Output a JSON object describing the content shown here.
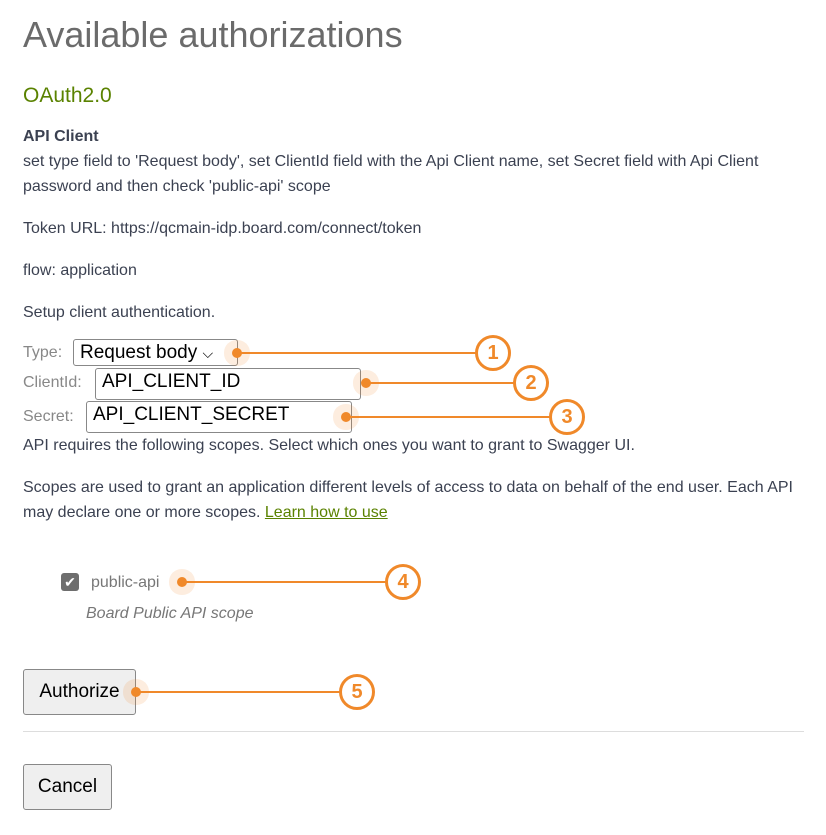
{
  "title": "Available authorizations",
  "scheme": "OAuth2.0",
  "client_name": "API Client",
  "description": "set type field to 'Request body', set ClientId field with the Api Client name, set Secret field with Api Client password and then check 'public-api' scope",
  "token_url": "Token URL: https://qcmain-idp.board.com/connect/token",
  "flow": "flow: application",
  "setup": "Setup client authentication.",
  "type_label": "Type:",
  "type_value": "Request body",
  "clientid_label": "ClientId:",
  "clientid_value": "API_CLIENT_ID",
  "secret_label": "Secret:",
  "secret_value": "API_CLIENT_SECRET",
  "scopes_required": "API requires the following scopes. Select which ones you want to grant to Swagger UI.",
  "scopes_info": "Scopes are used to grant an application different levels of access to data on behalf of the end user. Each API may declare one or more scopes.",
  "learn_link": "Learn how to use",
  "scope": {
    "name": "public-api",
    "checked": true,
    "description": "Board Public API scope"
  },
  "authorize_label": "Authorize",
  "cancel_label": "Cancel",
  "callouts": [
    "1",
    "2",
    "3",
    "4",
    "5"
  ],
  "accent_color": "#f0892a"
}
